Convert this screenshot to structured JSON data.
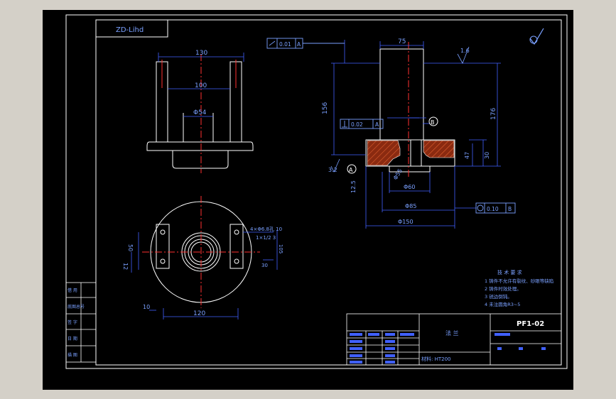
{
  "drawing": {
    "code_box": "ZD-Lihd",
    "part_number": "PF1-02",
    "title_name": "法 兰",
    "material": "材料: HT200",
    "roughness_symbol": "√"
  },
  "top_view": {
    "dim_overall_width": "130",
    "dim_inner": "100",
    "dim_bore": "Φ54"
  },
  "plan_view": {
    "dim_width": "120",
    "dim_bottom": "10",
    "dim_left_1": "50",
    "dim_left_2": "12",
    "dim_right_1": "30",
    "dim_right_2": "105",
    "hole_note_line1": "4×Φ6.8孔 10",
    "hole_note_line2": "1×1/2 3"
  },
  "section_view": {
    "dim_top_width": "75",
    "dim_total_height": "156",
    "dim_right_height": "176",
    "dim_flange_h1": "47",
    "dim_flange_h2": "30",
    "dim_phi150": "Φ150",
    "dim_phi85": "Φ85",
    "dim_phi60": "Φ60",
    "dim_phi55": "Φ55",
    "dim_angle": "12.5",
    "dim_3_2": "3.2",
    "tol_top": "0.01",
    "tol_top_datum": "A",
    "tol_perp": "0.02",
    "tol_perp_datum": "A",
    "tol_bottom": "0.10",
    "tol_bottom_datum": "B",
    "datum_a": "A",
    "datum_b": "B",
    "roughness_right": "1.6"
  },
  "notes": {
    "title": "技 术 要 求",
    "items": [
      "1  铸件不允许有裂纹、砂眼等缺陷",
      "2  铸件时效处理。",
      "3  锐边倒钝。",
      "4  未注圆角R3~5"
    ]
  },
  "side_table": {
    "rows": [
      "借 用",
      "底图总号",
      "签 字",
      "日 期",
      "描 图"
    ]
  }
}
